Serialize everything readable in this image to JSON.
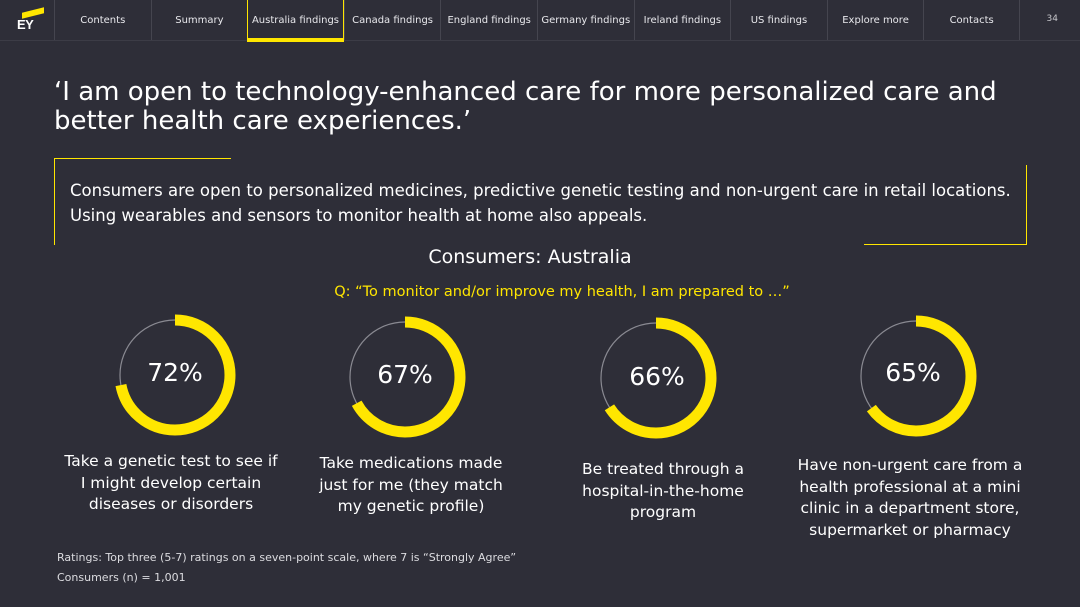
{
  "logo": {
    "text": "EY"
  },
  "nav": {
    "items": [
      {
        "label": "Contents",
        "active": false
      },
      {
        "label": "Summary",
        "active": false
      },
      {
        "label": "Australia findings",
        "active": true
      },
      {
        "label": "Canada findings",
        "active": false
      },
      {
        "label": "England findings",
        "active": false
      },
      {
        "label": "Germany findings",
        "active": false
      },
      {
        "label": "Ireland findings",
        "active": false
      },
      {
        "label": "US findings",
        "active": false
      },
      {
        "label": "Explore more",
        "active": false
      },
      {
        "label": "Contacts",
        "active": false
      }
    ],
    "page_number": "34"
  },
  "headline": "‘I am open to technology-enhanced care for more personalized care and better health care experiences.’",
  "callout": "Consumers are open to personalized medicines, predictive genetic testing and non-urgent care in retail locations. Using wearables and sensors to monitor health at home also appeals.",
  "section_title": "Consumers: Australia",
  "question": "Q: “To monitor and/or improve my health, I am prepared to …”",
  "stats": [
    {
      "value": 72,
      "label": "72%",
      "caption": "Take a genetic test to see if I might develop certain diseases or disorders"
    },
    {
      "value": 67,
      "label": "67%",
      "caption": "Take medications made just for me (they match my genetic profile)"
    },
    {
      "value": 66,
      "label": "66%",
      "caption": "Be treated through a hospital-in-the-home program"
    },
    {
      "value": 65,
      "label": "65%",
      "caption": "Have non-urgent care from a health professional at a mini clinic in a department store, supermarket or pharmacy"
    }
  ],
  "footnote": {
    "ratings": "Ratings: Top three (5-7) ratings on a seven-point scale, where 7 is “Strongly Agree”",
    "sample": "Consumers (n) = 1,001"
  },
  "colors": {
    "accent": "#ffe600",
    "background": "#2e2e38",
    "track": "#8a8a92"
  }
}
